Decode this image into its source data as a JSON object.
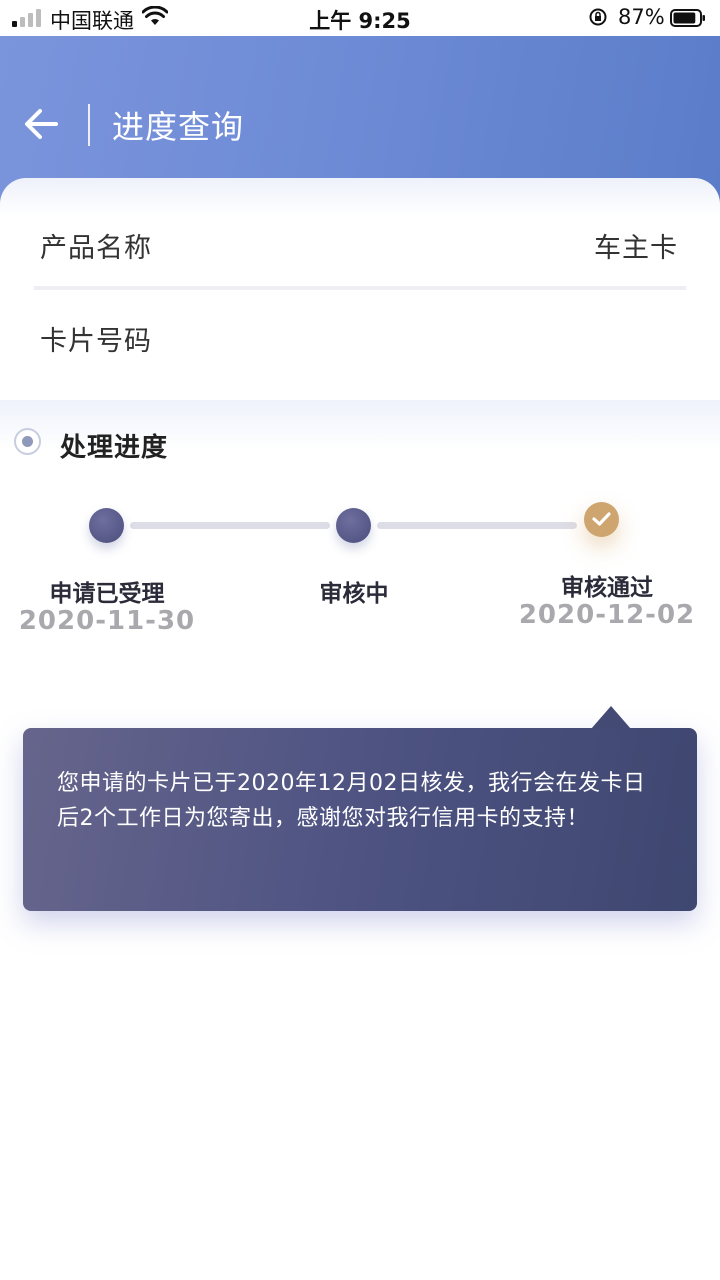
{
  "status_bar": {
    "carrier": "中国联通",
    "time": "上午 9:25",
    "battery_percent": "87%",
    "battery_level": 0.87
  },
  "header": {
    "title": "进度查询"
  },
  "info": {
    "product_label": "产品名称",
    "product_value": "车主卡",
    "card_number_label": "卡片号码"
  },
  "progress": {
    "section_title": "处理进度",
    "steps": [
      {
        "label": "申请已受理",
        "date": "2020-11-30",
        "status": "completed"
      },
      {
        "label": "审核中",
        "date": "",
        "status": "completed"
      },
      {
        "label": "审核通过",
        "date": "2020-12-02",
        "status": "current"
      }
    ]
  },
  "tooltip": {
    "message": "您申请的卡片已于2020年12月02日核发，我行会在发卡日后2个工作日为您寄出，感谢您对我行信用卡的支持！"
  },
  "colors": {
    "header_accent": "#6e8bd6",
    "step_dark": "#4a4d7c",
    "step_done": "#cea46f",
    "tooltip_bg": "#4e5382"
  }
}
